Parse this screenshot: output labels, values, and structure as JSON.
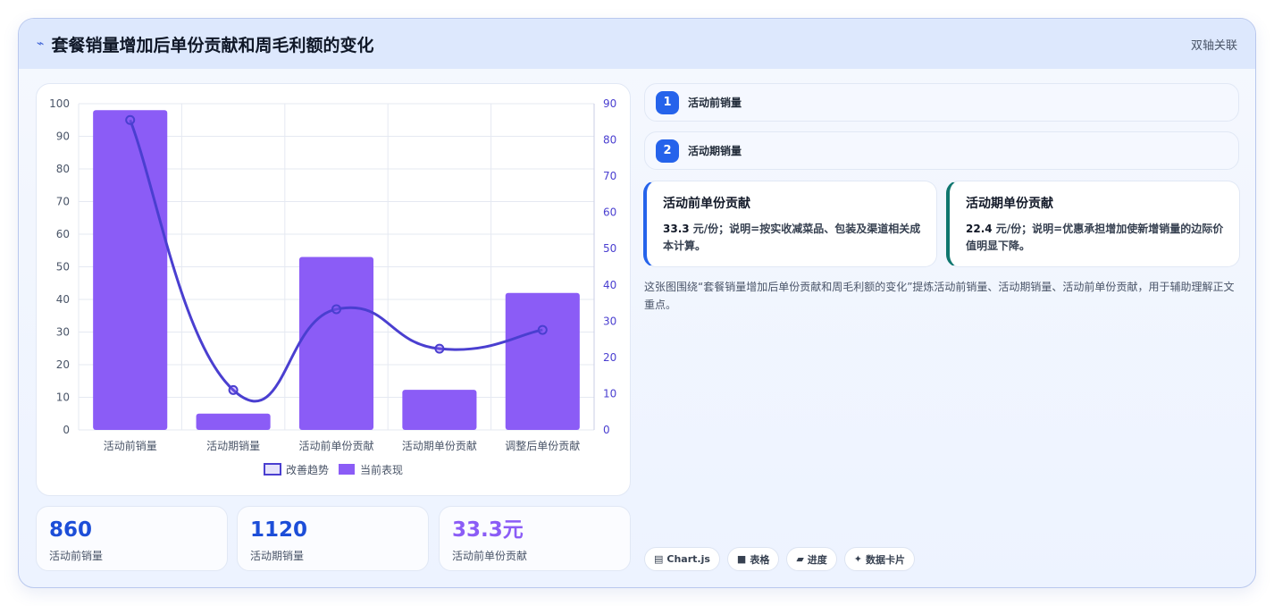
{
  "header": {
    "icon": "sparkline-icon",
    "title": "套餐销量增加后单份贡献和周毛利额的变化",
    "badge": "双轴关联"
  },
  "chart_data": {
    "type": "bar",
    "categories": [
      "活动前销量",
      "活动期销量",
      "活动前单份贡献",
      "活动期单份贡献",
      "调整后单份贡献"
    ],
    "series": [
      {
        "name": "改善趋势",
        "type": "line",
        "axis": "right",
        "values": [
          85.5,
          11,
          33.3,
          22.4,
          27.6
        ]
      },
      {
        "name": "当前表现",
        "type": "bar",
        "axis": "left",
        "values": [
          98,
          5,
          53,
          12.3,
          42
        ]
      }
    ],
    "y_left": {
      "min": 0,
      "max": 100,
      "ticks": [
        "0",
        "10",
        "20",
        "30",
        "40",
        "50",
        "60",
        "70",
        "80",
        "90",
        "100"
      ]
    },
    "y_right": {
      "min": 0,
      "max": 90,
      "ticks": [
        "0",
        "10",
        "20",
        "30",
        "40",
        "50",
        "60",
        "70",
        "80",
        "90"
      ]
    },
    "grid": true,
    "legend": "bottom",
    "colors": {
      "bar": "#8b5cf6",
      "line": "#4a3fd0",
      "grid": "#e5e9f2",
      "left_tick": "#4a5568",
      "right_tick": "#4a3fd0"
    }
  },
  "kpis": [
    {
      "value": "860",
      "label": "活动前销量",
      "color": "#1d4ed8"
    },
    {
      "value": "1120",
      "label": "活动期销量",
      "color": "#1d4ed8"
    },
    {
      "value": "33.3元",
      "label": "活动前单份贡献",
      "color": "#8b5cf6"
    }
  ],
  "steps": [
    {
      "num": "1",
      "label": "活动前销量"
    },
    {
      "num": "2",
      "label": "活动期销量"
    }
  ],
  "info_cards": [
    {
      "title": "活动前单份贡献",
      "value": "33.3",
      "text": "元/份；说明=按实收减菜品、包装及渠道相关成本计算。",
      "accent": "#2563eb"
    },
    {
      "title": "活动期单份贡献",
      "value": "22.4",
      "text": "元/份；说明=优惠承担增加使新增销量的边际价值明显下降。",
      "accent": "#0f766e"
    }
  ],
  "description": "这张图围绕“套餐销量增加后单份贡献和周毛利额的变化”提炼活动前销量、活动期销量、活动前单份贡献，用于辅助理解正文重点。",
  "chips": [
    {
      "icon": "chart-icon",
      "glyph": "▤",
      "label": "Chart.js"
    },
    {
      "icon": "table-icon",
      "glyph": "■",
      "label": "表格"
    },
    {
      "icon": "progress-icon",
      "glyph": "▰",
      "label": "进度"
    },
    {
      "icon": "card-icon",
      "glyph": "✦",
      "label": "数据卡片"
    }
  ]
}
